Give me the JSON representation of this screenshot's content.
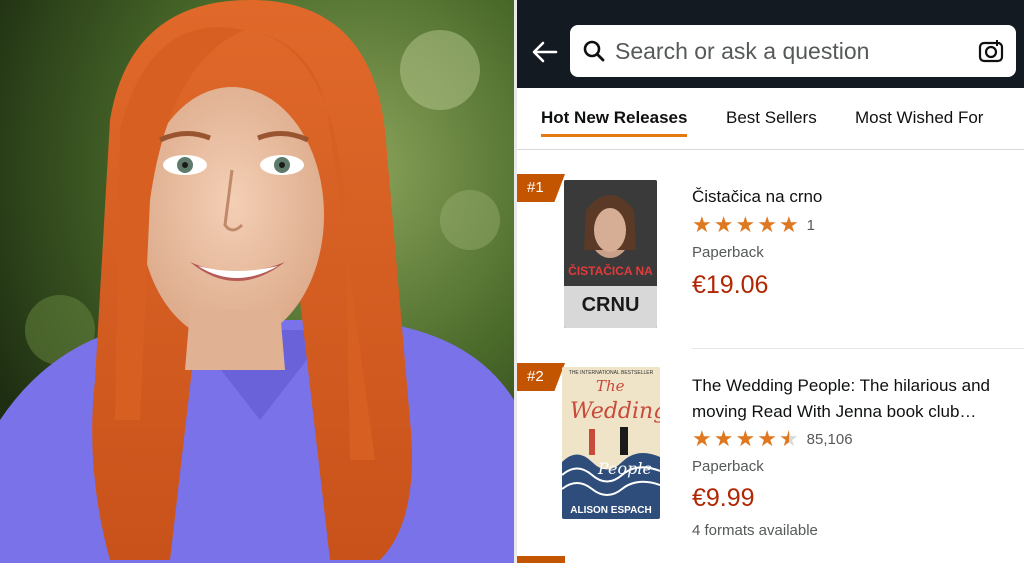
{
  "search": {
    "placeholder": "Search or ask a question"
  },
  "tabs": [
    {
      "label": "Hot New Releases",
      "active": true
    },
    {
      "label": "Best Sellers",
      "active": false
    },
    {
      "label": "Most Wished For",
      "active": false
    }
  ],
  "products": [
    {
      "rank": "#1",
      "title": "Čistačica na crno",
      "rating": 5,
      "review_count": "1",
      "format": "Paperback",
      "price": "€19.06",
      "cover_text": "ČISTAČICA NA",
      "cover_text2": "CRNU"
    },
    {
      "rank": "#2",
      "title": "The Wedding People: The hilarious and moving Read With Jenna book club…",
      "rating": 4.5,
      "review_count": "85,106",
      "format": "Paperback",
      "price": "€9.99",
      "formats_note": "4 formats available",
      "cover_top": "THE INTERNATIONAL BESTSELLER",
      "cover_title1": "The",
      "cover_title2": "Wedding",
      "cover_title3": "People",
      "cover_author": "ALISON ESPACH"
    }
  ],
  "colors": {
    "topbar": "#131a22",
    "accent": "#e47911",
    "rank_badge": "#c45500",
    "price": "#b12704",
    "star": "#de7921"
  }
}
